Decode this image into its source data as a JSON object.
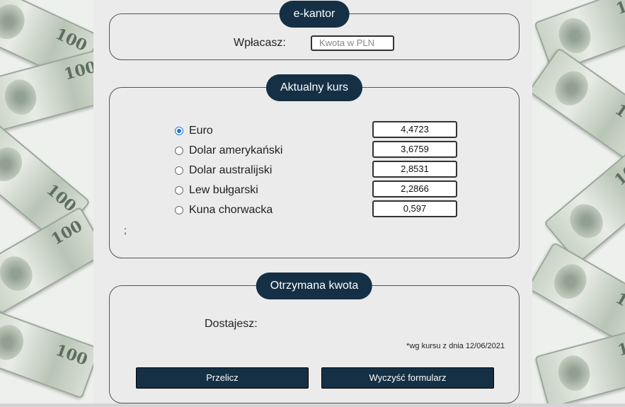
{
  "header": {
    "title": "e-kantor"
  },
  "deposit": {
    "label": "Wpłacasz:",
    "placeholder": "Kwota w PLN",
    "value": ""
  },
  "rates": {
    "title": "Aktualny kurs",
    "items": [
      {
        "name": "Euro",
        "value": "4,4723",
        "selected": true
      },
      {
        "name": "Dolar amerykański",
        "value": "3,6759",
        "selected": false
      },
      {
        "name": "Dolar australijski",
        "value": "2,8531",
        "selected": false
      },
      {
        "name": "Lew bułgarski",
        "value": "2,2866",
        "selected": false
      },
      {
        "name": "Kuna chorwacka",
        "value": "0,597",
        "selected": false
      }
    ],
    "stray_text": ";"
  },
  "result": {
    "title": "Otrzymana kwota",
    "label": "Dostajesz:",
    "note": "*wg kursu z dnia 12/06/2021",
    "calculate_label": "Przelicz",
    "clear_label": "Wyczyść formularz"
  },
  "colors": {
    "accent": "#153045",
    "radio_checked": "#1a73e8"
  }
}
